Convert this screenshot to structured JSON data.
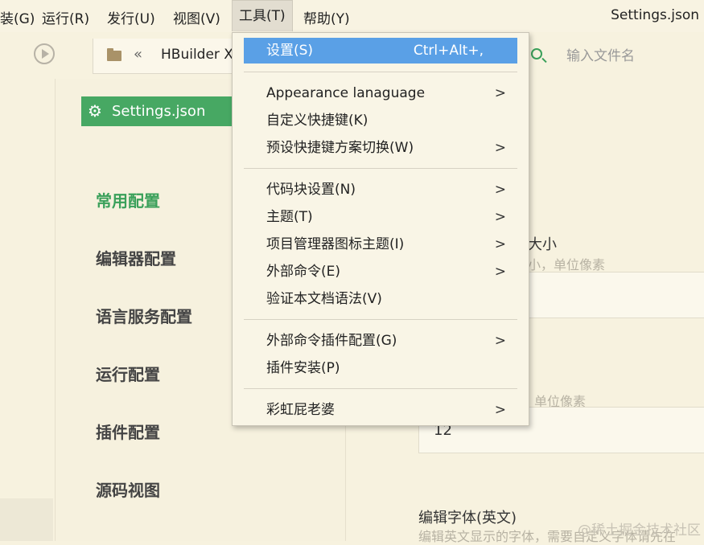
{
  "menubar": {
    "items": [
      "装(G)",
      "运行(R)",
      "发行(U)",
      "视图(V)",
      "工具(T)",
      "帮助(Y)"
    ],
    "title": "Settings.json"
  },
  "toolbar": {
    "breadcrumb": "HBuilder X",
    "search_placeholder": "输入文件名"
  },
  "sidebar": {
    "tab_label": "Settings.json",
    "items": [
      "常用配置",
      "编辑器配置",
      "语言服务配置",
      "运行配置",
      "插件配置",
      "源码视图"
    ]
  },
  "content": {
    "label1": "大小",
    "desc1": "小，单位像素",
    "desc2": "单位像素",
    "value2": "12",
    "label3": "编辑字体(英文)",
    "desc3": "编辑英文显示的字体，需要自定义字体请先在",
    "watermark": "@稀土掘金技术社区"
  },
  "dropdown": {
    "items": [
      {
        "label": "设置(S)",
        "shortcut": "Ctrl+Alt+,",
        "submenu": false
      },
      {
        "label": "Appearance lanaguage",
        "submenu": true
      },
      {
        "label": "自定义快捷键(K)",
        "submenu": false
      },
      {
        "label": "预设快捷键方案切换(W)",
        "submenu": true
      },
      {
        "label": "代码块设置(N)",
        "submenu": true
      },
      {
        "label": "主题(T)",
        "submenu": true
      },
      {
        "label": "项目管理器图标主题(I)",
        "submenu": true
      },
      {
        "label": "外部命令(E)",
        "submenu": true
      },
      {
        "label": "验证本文档语法(V)",
        "submenu": false
      },
      {
        "label": "外部命令插件配置(G)",
        "submenu": true
      },
      {
        "label": "插件安装(P)",
        "submenu": false
      },
      {
        "label": "彩虹屁老婆",
        "submenu": true
      }
    ]
  }
}
